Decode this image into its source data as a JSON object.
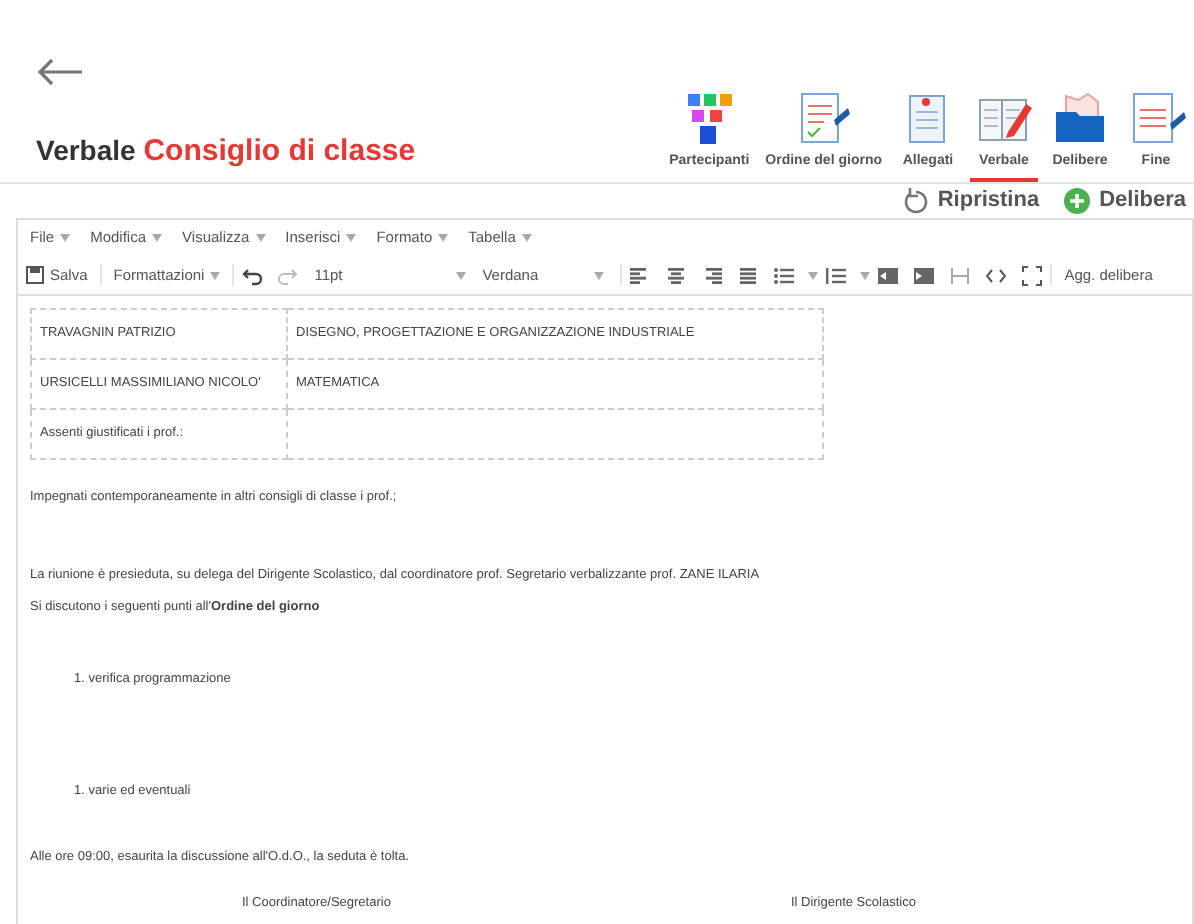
{
  "tabs": [
    {
      "label": "Partecipanti",
      "kind": "people",
      "selected": false
    },
    {
      "label": "Ordine del giorno",
      "kind": "checklist",
      "selected": false
    },
    {
      "label": "Allegati",
      "kind": "clipboard",
      "selected": false
    },
    {
      "label": "Verbale",
      "kind": "notebook",
      "selected": true
    },
    {
      "label": "Delibere",
      "kind": "folder",
      "selected": false
    },
    {
      "label": "Fine",
      "kind": "document",
      "selected": false
    }
  ],
  "title": {
    "prefix": "Verbale",
    "name": "Consiglio di classe"
  },
  "actions": [
    {
      "label": "Ripristina",
      "kind": "restore"
    },
    {
      "label": "Delibera",
      "kind": "add"
    }
  ],
  "menu": [
    "File",
    "Modifica",
    "Visualizza",
    "Inserisci",
    "Formato",
    "Tabella"
  ],
  "toolbar": {
    "save": "Salva",
    "formats": "Formattazioni",
    "font_size": "11pt",
    "font_family": "Verdana",
    "custom": "Agg. delibera"
  },
  "table": [
    [
      "TRAVAGNIN PATRIZIO",
      "DISEGNO, PROGETTAZIONE E ORGANIZZAZIONE INDUSTRIALE"
    ],
    [
      "URSICELLI MASSIMILIANO NICOLO'",
      "MATEMATICA"
    ],
    [
      "Assenti giustificati i prof.:"
    ]
  ],
  "blocks": [
    {
      "kind": "para",
      "text": "Impegnati contemporaneamente in altri consigli di classe i prof.;"
    },
    {
      "kind": "para",
      "text": "La riunione è presieduta, su delega del Dirigente Scolastico, dal coordinatore prof.   Segretario verbalizzante prof. ZANE ILARIA"
    },
    {
      "kind": "para",
      "text": "Si discutono i seguenti punti all'**Ordine del giorno**"
    },
    {
      "kind": "item",
      "number": "1.",
      "text": "verifica programmazione"
    },
    {
      "kind": "item",
      "number": "1.",
      "text": "varie ed eventuali"
    },
    {
      "kind": "para",
      "text": "Alle ore 09:00, esaurita la discussione all'O.d.O., la seduta è tolta."
    },
    {
      "kind": "signatures",
      "left": "Il Coordinatore/Segretario",
      "right": "Il Dirigente Scolastico"
    }
  ]
}
